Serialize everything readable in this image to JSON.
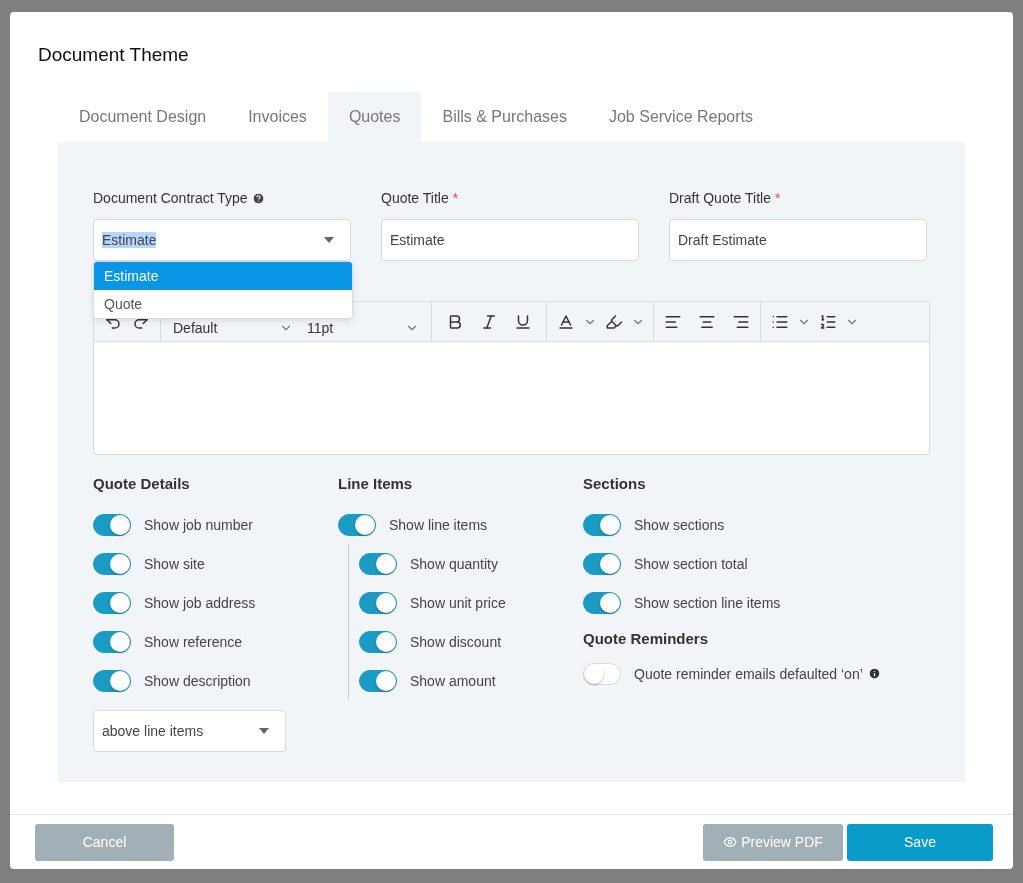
{
  "dialog": {
    "title": "Document Theme"
  },
  "tabs": [
    {
      "label": "Document Design",
      "selected": false
    },
    {
      "label": "Invoices",
      "selected": false
    },
    {
      "label": "Quotes",
      "selected": true
    },
    {
      "label": "Bills & Purchases",
      "selected": false
    },
    {
      "label": "Job Service Reports",
      "selected": false
    }
  ],
  "fields": [
    {
      "label": "Document Contract Type",
      "kind": "select",
      "value": "Estimate",
      "help": true
    },
    {
      "label": "Quote Title",
      "kind": "text",
      "value": "Estimate",
      "help": false,
      "required_mark": "*"
    },
    {
      "label": "Draft Quote Title",
      "kind": "text",
      "value": "Draft Estimate",
      "help": false,
      "required_mark": "*"
    }
  ],
  "dropdown": {
    "options": [
      {
        "label": "Estimate",
        "selected": true
      },
      {
        "label": "Quote",
        "selected": false
      }
    ]
  },
  "editor": {
    "font": "Default",
    "size": "11pt"
  },
  "quote_details": {
    "heading": "Quote Details",
    "toggles": [
      {
        "label": "Show job number",
        "on": true
      },
      {
        "label": "Show site",
        "on": true
      },
      {
        "label": "Show job address",
        "on": true
      },
      {
        "label": "Show reference",
        "on": true
      },
      {
        "label": "Show description",
        "on": true
      }
    ],
    "position": "above line items"
  },
  "line_items": {
    "heading": "Line Items",
    "toggle": {
      "label": "Show line items",
      "on": true
    },
    "children": [
      {
        "label": "Show quantity",
        "on": true
      },
      {
        "label": "Show unit price",
        "on": true
      },
      {
        "label": "Show discount",
        "on": true
      },
      {
        "label": "Show amount",
        "on": true
      }
    ]
  },
  "sections": {
    "heading": "Sections",
    "toggles": [
      {
        "label": "Show sections",
        "on": true
      },
      {
        "label": "Show section total",
        "on": true
      },
      {
        "label": "Show section line items",
        "on": true
      }
    ]
  },
  "reminders": {
    "heading": "Quote Reminders",
    "toggles": [
      {
        "label": "Quote reminder emails defaulted ‘on’",
        "on": false,
        "info": true
      }
    ]
  },
  "footer": {
    "cancel": "Cancel",
    "preview": "Preview PDF",
    "save": "Save"
  }
}
